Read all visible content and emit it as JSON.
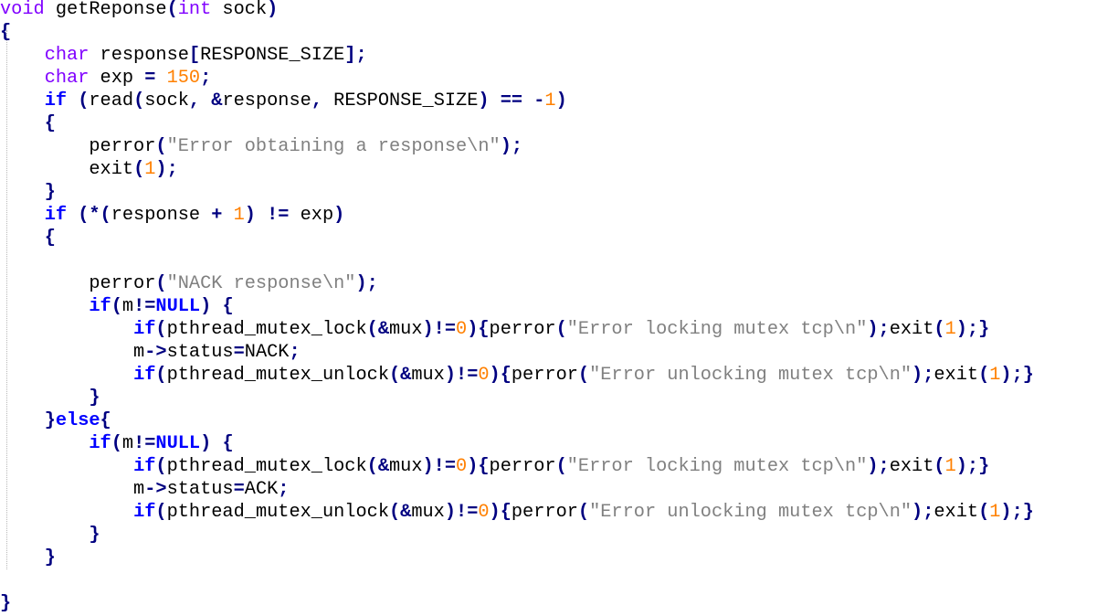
{
  "editor": {
    "language": "C",
    "colors": {
      "keyword": "#0000ff",
      "type": "#8000ff",
      "operator": "#000080",
      "number": "#ff8000",
      "string": "#808080",
      "identifier": "#000000"
    },
    "lines": [
      [
        [
          "type",
          "void"
        ],
        [
          "id",
          " getReponse"
        ],
        [
          "op",
          "("
        ],
        [
          "type",
          "int"
        ],
        [
          "id",
          " sock"
        ],
        [
          "op",
          ")"
        ]
      ],
      [
        [
          "op",
          "{"
        ]
      ],
      [
        [
          "id",
          "    "
        ],
        [
          "type",
          "char"
        ],
        [
          "id",
          " response"
        ],
        [
          "op",
          "["
        ],
        [
          "id",
          "RESPONSE_SIZE"
        ],
        [
          "op",
          "];"
        ]
      ],
      [
        [
          "id",
          "    "
        ],
        [
          "type",
          "char"
        ],
        [
          "id",
          " exp "
        ],
        [
          "op",
          "="
        ],
        [
          "id",
          " "
        ],
        [
          "num",
          "150"
        ],
        [
          "op",
          ";"
        ]
      ],
      [
        [
          "id",
          "    "
        ],
        [
          "keyword",
          "if"
        ],
        [
          "id",
          " "
        ],
        [
          "op",
          "("
        ],
        [
          "id",
          "read"
        ],
        [
          "op",
          "("
        ],
        [
          "id",
          "sock"
        ],
        [
          "op",
          ","
        ],
        [
          "id",
          " "
        ],
        [
          "op",
          "&"
        ],
        [
          "id",
          "response"
        ],
        [
          "op",
          ","
        ],
        [
          "id",
          " RESPONSE_SIZE"
        ],
        [
          "op",
          ")"
        ],
        [
          "id",
          " "
        ],
        [
          "op",
          "=="
        ],
        [
          "id",
          " "
        ],
        [
          "op",
          "-"
        ],
        [
          "num",
          "1"
        ],
        [
          "op",
          ")"
        ]
      ],
      [
        [
          "id",
          "    "
        ],
        [
          "op",
          "{"
        ]
      ],
      [
        [
          "id",
          "        perror"
        ],
        [
          "op",
          "("
        ],
        [
          "str",
          "\"Error obtaining a response\\n\""
        ],
        [
          "op",
          ");"
        ]
      ],
      [
        [
          "id",
          "        exit"
        ],
        [
          "op",
          "("
        ],
        [
          "num",
          "1"
        ],
        [
          "op",
          ");"
        ]
      ],
      [
        [
          "id",
          "    "
        ],
        [
          "op",
          "}"
        ]
      ],
      [
        [
          "id",
          "    "
        ],
        [
          "keyword",
          "if"
        ],
        [
          "id",
          " "
        ],
        [
          "op",
          "(*("
        ],
        [
          "id",
          "response "
        ],
        [
          "op",
          "+"
        ],
        [
          "id",
          " "
        ],
        [
          "num",
          "1"
        ],
        [
          "op",
          ")"
        ],
        [
          "id",
          " "
        ],
        [
          "op",
          "!="
        ],
        [
          "id",
          " exp"
        ],
        [
          "op",
          ")"
        ]
      ],
      [
        [
          "id",
          "    "
        ],
        [
          "op",
          "{"
        ]
      ],
      [
        [
          "id",
          ""
        ]
      ],
      [
        [
          "id",
          "        perror"
        ],
        [
          "op",
          "("
        ],
        [
          "str",
          "\"NACK response\\n\""
        ],
        [
          "op",
          ");"
        ]
      ],
      [
        [
          "id",
          "        "
        ],
        [
          "keyword",
          "if"
        ],
        [
          "op",
          "("
        ],
        [
          "id",
          "m"
        ],
        [
          "op",
          "!="
        ],
        [
          "keyword",
          "NULL"
        ],
        [
          "op",
          ")"
        ],
        [
          "id",
          " "
        ],
        [
          "op",
          "{"
        ]
      ],
      [
        [
          "id",
          "            "
        ],
        [
          "keyword",
          "if"
        ],
        [
          "op",
          "("
        ],
        [
          "id",
          "pthread_mutex_lock"
        ],
        [
          "op",
          "(&"
        ],
        [
          "id",
          "mux"
        ],
        [
          "op",
          ")!="
        ],
        [
          "num",
          "0"
        ],
        [
          "op",
          "){"
        ],
        [
          "id",
          "perror"
        ],
        [
          "op",
          "("
        ],
        [
          "str",
          "\"Error locking mutex tcp\\n\""
        ],
        [
          "op",
          ");"
        ],
        [
          "id",
          "exit"
        ],
        [
          "op",
          "("
        ],
        [
          "num",
          "1"
        ],
        [
          "op",
          ");}"
        ]
      ],
      [
        [
          "id",
          "            m"
        ],
        [
          "op",
          "->"
        ],
        [
          "id",
          "status"
        ],
        [
          "op",
          "="
        ],
        [
          "id",
          "NACK"
        ],
        [
          "op",
          ";"
        ]
      ],
      [
        [
          "id",
          "            "
        ],
        [
          "keyword",
          "if"
        ],
        [
          "op",
          "("
        ],
        [
          "id",
          "pthread_mutex_unlock"
        ],
        [
          "op",
          "(&"
        ],
        [
          "id",
          "mux"
        ],
        [
          "op",
          ")!="
        ],
        [
          "num",
          "0"
        ],
        [
          "op",
          "){"
        ],
        [
          "id",
          "perror"
        ],
        [
          "op",
          "("
        ],
        [
          "str",
          "\"Error unlocking mutex tcp\\n\""
        ],
        [
          "op",
          ");"
        ],
        [
          "id",
          "exit"
        ],
        [
          "op",
          "("
        ],
        [
          "num",
          "1"
        ],
        [
          "op",
          ");}"
        ]
      ],
      [
        [
          "id",
          "        "
        ],
        [
          "op",
          "}"
        ]
      ],
      [
        [
          "id",
          "    "
        ],
        [
          "op",
          "}"
        ],
        [
          "keyword",
          "else"
        ],
        [
          "op",
          "{"
        ]
      ],
      [
        [
          "id",
          "        "
        ],
        [
          "keyword",
          "if"
        ],
        [
          "op",
          "("
        ],
        [
          "id",
          "m"
        ],
        [
          "op",
          "!="
        ],
        [
          "keyword",
          "NULL"
        ],
        [
          "op",
          ")"
        ],
        [
          "id",
          " "
        ],
        [
          "op",
          "{"
        ]
      ],
      [
        [
          "id",
          "            "
        ],
        [
          "keyword",
          "if"
        ],
        [
          "op",
          "("
        ],
        [
          "id",
          "pthread_mutex_lock"
        ],
        [
          "op",
          "(&"
        ],
        [
          "id",
          "mux"
        ],
        [
          "op",
          ")!="
        ],
        [
          "num",
          "0"
        ],
        [
          "op",
          "){"
        ],
        [
          "id",
          "perror"
        ],
        [
          "op",
          "("
        ],
        [
          "str",
          "\"Error locking mutex tcp\\n\""
        ],
        [
          "op",
          ");"
        ],
        [
          "id",
          "exit"
        ],
        [
          "op",
          "("
        ],
        [
          "num",
          "1"
        ],
        [
          "op",
          ");}"
        ]
      ],
      [
        [
          "id",
          "            m"
        ],
        [
          "op",
          "->"
        ],
        [
          "id",
          "status"
        ],
        [
          "op",
          "="
        ],
        [
          "id",
          "ACK"
        ],
        [
          "op",
          ";"
        ]
      ],
      [
        [
          "id",
          "            "
        ],
        [
          "keyword",
          "if"
        ],
        [
          "op",
          "("
        ],
        [
          "id",
          "pthread_mutex_unlock"
        ],
        [
          "op",
          "(&"
        ],
        [
          "id",
          "mux"
        ],
        [
          "op",
          ")!="
        ],
        [
          "num",
          "0"
        ],
        [
          "op",
          "){"
        ],
        [
          "id",
          "perror"
        ],
        [
          "op",
          "("
        ],
        [
          "str",
          "\"Error unlocking mutex tcp\\n\""
        ],
        [
          "op",
          ");"
        ],
        [
          "id",
          "exit"
        ],
        [
          "op",
          "("
        ],
        [
          "num",
          "1"
        ],
        [
          "op",
          ");}"
        ]
      ],
      [
        [
          "id",
          "        "
        ],
        [
          "op",
          "}"
        ]
      ],
      [
        [
          "id",
          "    "
        ],
        [
          "op",
          "}"
        ]
      ],
      [
        [
          "id",
          ""
        ]
      ],
      [
        [
          "op",
          "}"
        ]
      ]
    ]
  }
}
